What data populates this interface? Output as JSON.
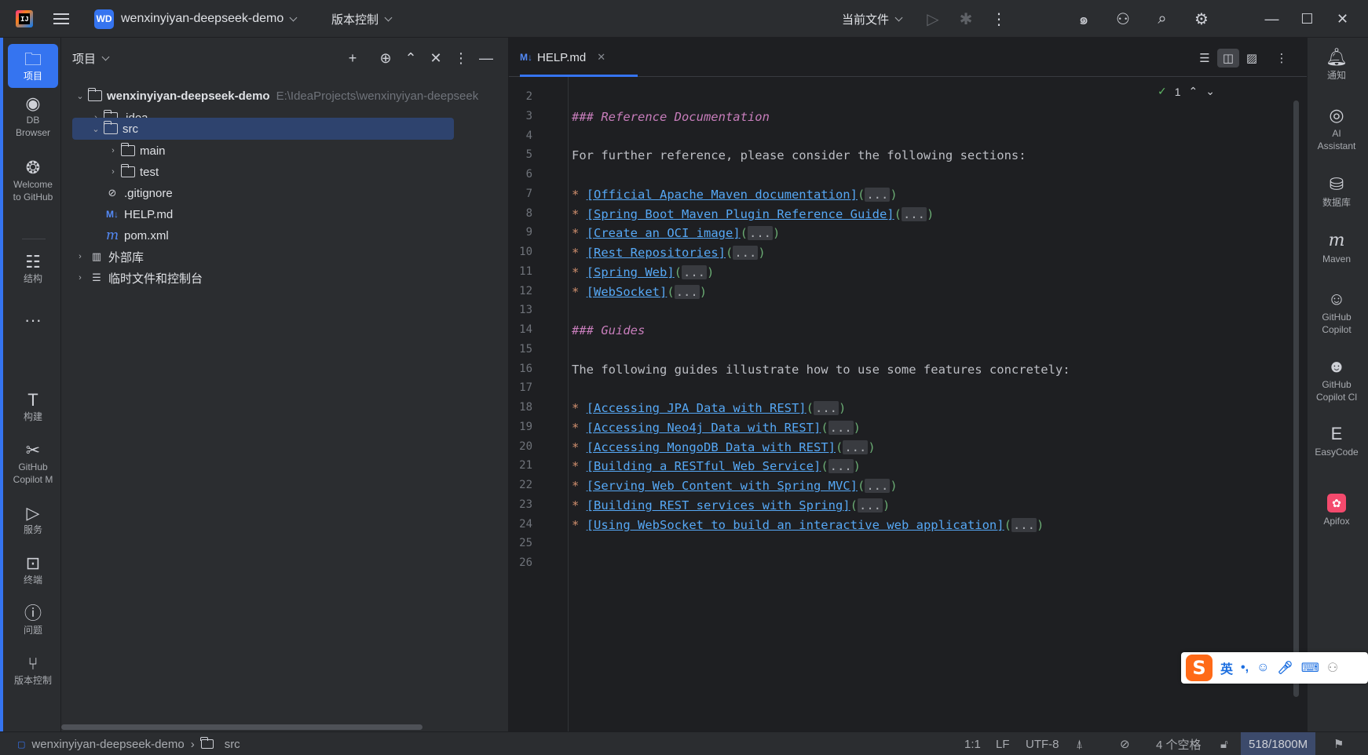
{
  "titlebar": {
    "project_initials": "WD",
    "project_name": "wenxinyiyan-deepseek-demo",
    "vcs_label": "版本控制",
    "run_config": "当前文件"
  },
  "leftbar": {
    "items": [
      {
        "label": "项目",
        "icon": "folder-icon"
      },
      {
        "label": "DB\nBrowser",
        "icon": "db-browser-icon"
      },
      {
        "label": "Welcome\nto GitHub",
        "icon": "github-icon"
      },
      {
        "label": "结构",
        "icon": "structure-icon"
      },
      {
        "label": "构建",
        "icon": "hammer-icon"
      },
      {
        "label": "GitHub\nCopilot M",
        "icon": "tools-icon"
      },
      {
        "label": "服务",
        "icon": "services-icon"
      },
      {
        "label": "终端",
        "icon": "terminal-icon"
      },
      {
        "label": "问题",
        "icon": "problems-icon"
      },
      {
        "label": "版本控制",
        "icon": "vcs-icon"
      }
    ]
  },
  "rightbar": {
    "items": [
      {
        "label": "通知"
      },
      {
        "label": "AI\nAssistant"
      },
      {
        "label": "数据库"
      },
      {
        "label": "Maven"
      },
      {
        "label": "GitHub\nCopilot"
      },
      {
        "label": "GitHub\nCopilot Cl"
      },
      {
        "label": "EasyCode"
      },
      {
        "label": "Apifox"
      }
    ]
  },
  "project_panel": {
    "title": "项目",
    "tree": [
      {
        "label": "wenxinyiyan-deepseek-demo",
        "hint": "E:\\IdeaProjects\\wenxinyiyan-deepseek"
      },
      {
        "label": ".idea"
      },
      {
        "label": "src"
      },
      {
        "label": "main"
      },
      {
        "label": "test"
      },
      {
        "label": ".gitignore"
      },
      {
        "label": "HELP.md"
      },
      {
        "label": "pom.xml"
      },
      {
        "label": "外部库"
      },
      {
        "label": "临时文件和控制台"
      }
    ]
  },
  "editor": {
    "tab_label": "HELP.md",
    "inspection_count": "1",
    "line_numbers": [
      "2",
      "3",
      "4",
      "5",
      "6",
      "7",
      "8",
      "9",
      "10",
      "11",
      "12",
      "13",
      "14",
      "15",
      "16",
      "17",
      "18",
      "19",
      "20",
      "21",
      "22",
      "23",
      "24",
      "25",
      "26"
    ],
    "heading_ref": "### Reference Documentation",
    "intro_ref": "For further reference, please consider the following sections:",
    "ref_links": [
      "[Official Apache Maven documentation]",
      "[Spring Boot Maven Plugin Reference Guide]",
      "[Create an OCI image]",
      "[Rest Repositories]",
      "[Spring Web]",
      "[WebSocket]"
    ],
    "heading_guides": "### Guides",
    "intro_guides": "The following guides illustrate how to use some features concretely:",
    "guide_links": [
      "[Accessing JPA Data with REST]",
      "[Accessing Neo4j Data with REST]",
      "[Accessing MongoDB Data with REST]",
      "[Building a RESTful Web Service]",
      "[Serving Web Content with Spring MVC]",
      "[Building REST services with Spring]",
      "[Using WebSocket to build an interactive web application]"
    ],
    "fold_text": "...",
    "bullet": "*"
  },
  "statusbar": {
    "crumb_project": "wenxinyiyan-deepseek-demo",
    "crumb_src": "src",
    "position": "1:1",
    "line_sep": "LF",
    "encoding": "UTF-8",
    "indent": "4 个空格",
    "memory": "518/1800M"
  },
  "ime": {
    "lang": "英"
  }
}
